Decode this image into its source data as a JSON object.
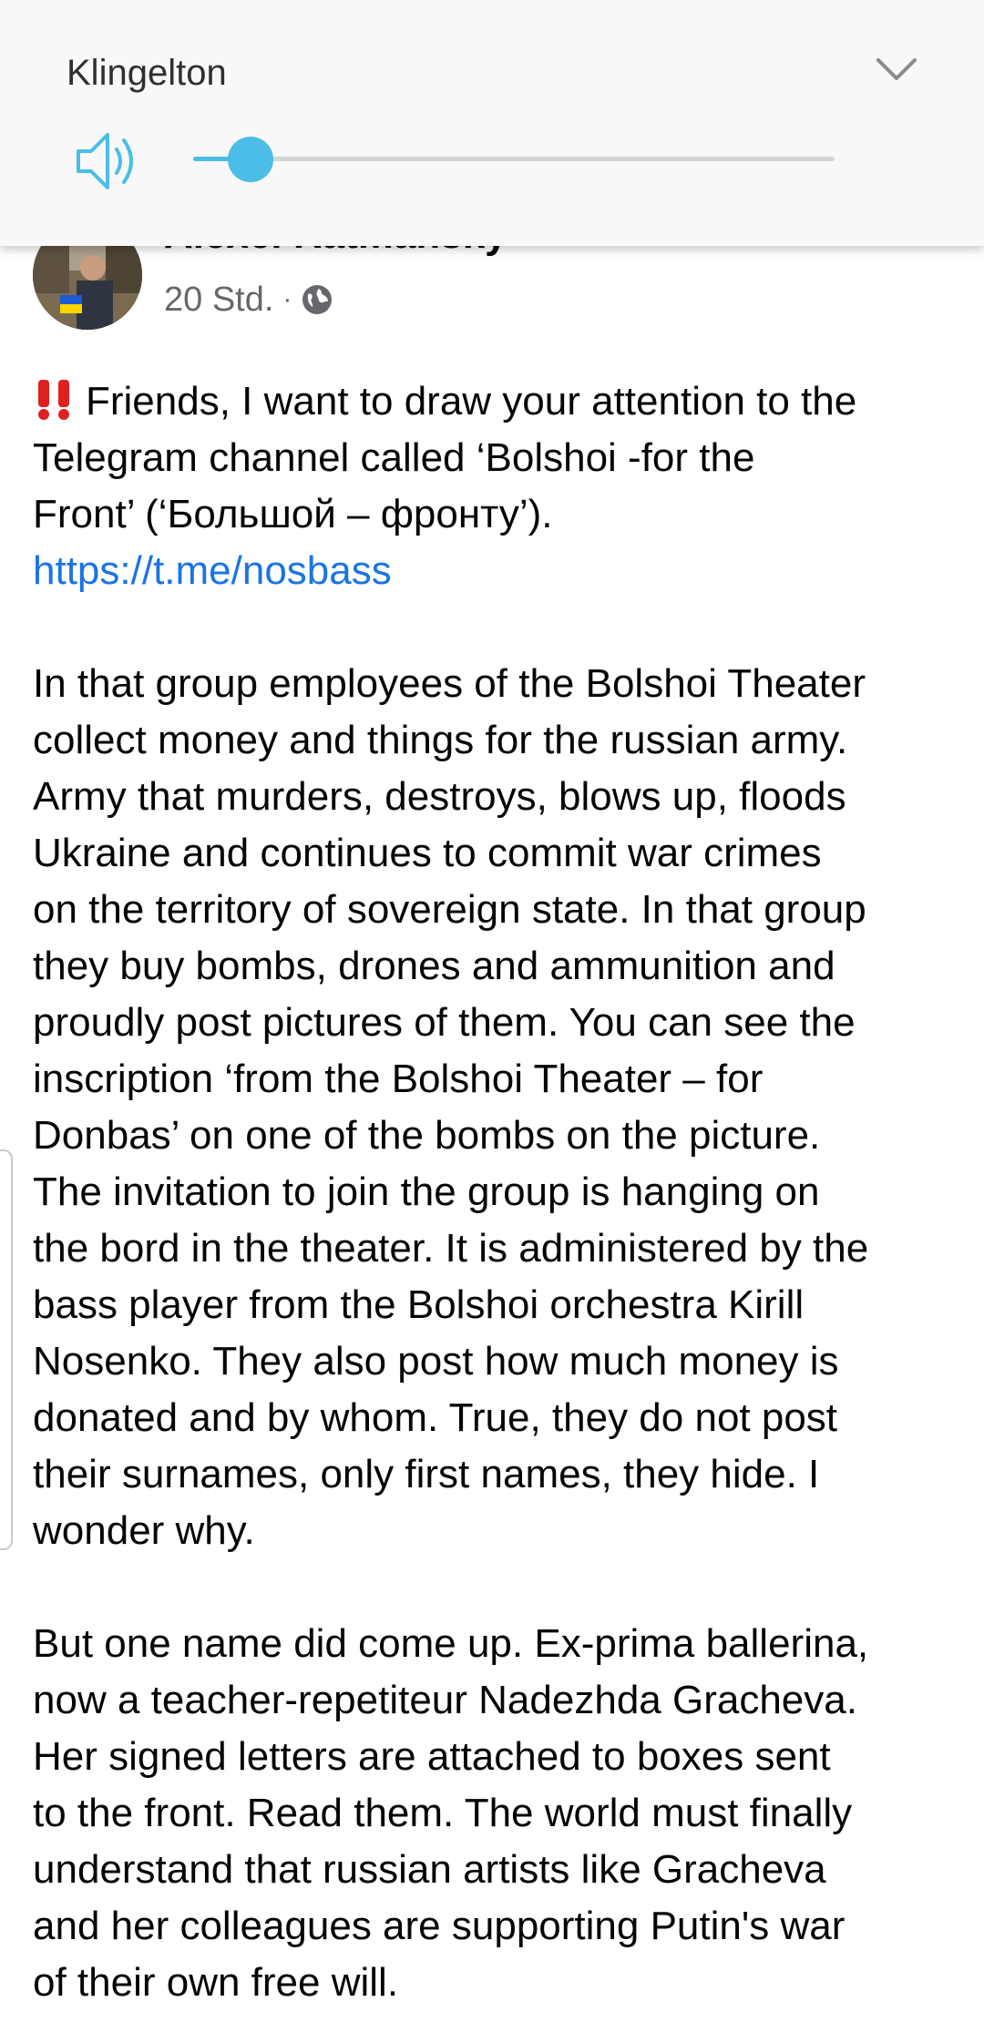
{
  "volume_panel": {
    "title": "Klingelton",
    "level": 0.09,
    "accent_color": "#4bbde6",
    "icons": [
      "speaker-icon",
      "chevron-down-icon"
    ]
  },
  "post": {
    "author": "Alexei Ratmansky",
    "time": "20 Std.",
    "separator": "·",
    "audience_icon": "globe-icon",
    "more_icon": "more-options-icon",
    "more_label": "···",
    "link_color": "#1b74e4",
    "paragraph1": {
      "emoji": "bangbang-icon",
      "lines": [
        "Friends, I want to draw your attention to the",
        "Telegram channel called ‘Bolshoi -for the",
        "Front’ (‘Большой – фронту’)."
      ],
      "link": "https://t.me/nosbass"
    },
    "paragraph2": {
      "lines": [
        "In that group employees of the Bolshoi Theater",
        "collect money and things for the russian army.",
        "Army that murders, destroys, blows up, floods",
        "Ukraine and continues to commit war crimes",
        "on the territory of sovereign state. In that group",
        "they buy bombs, drones and ammunition and",
        "proudly post pictures of them. You can see the",
        "inscription ‘from the Bolshoi Theater – for",
        "Donbas’ on one of the bombs on the picture.",
        "The invitation to join the group is hanging on",
        "the bord in the theater. It is administered by the",
        "bass player from the Bolshoi orchestra Kirill",
        "Nosenko. They also post how much money is",
        "donated and by whom. True, they do not post",
        "their surnames, only first names, they hide. I",
        "wonder why."
      ]
    },
    "paragraph3": {
      "lines": [
        "But one name did come up. Ex-prima ballerina,",
        "now a teacher-repetiteur Nadezhda Gracheva.",
        "Her signed letters are attached to boxes sent",
        "to the front. Read them. The world must finally",
        "understand that russian artists like Gracheva",
        "and her colleagues are supporting Putin's war",
        "of their own free will."
      ]
    }
  }
}
